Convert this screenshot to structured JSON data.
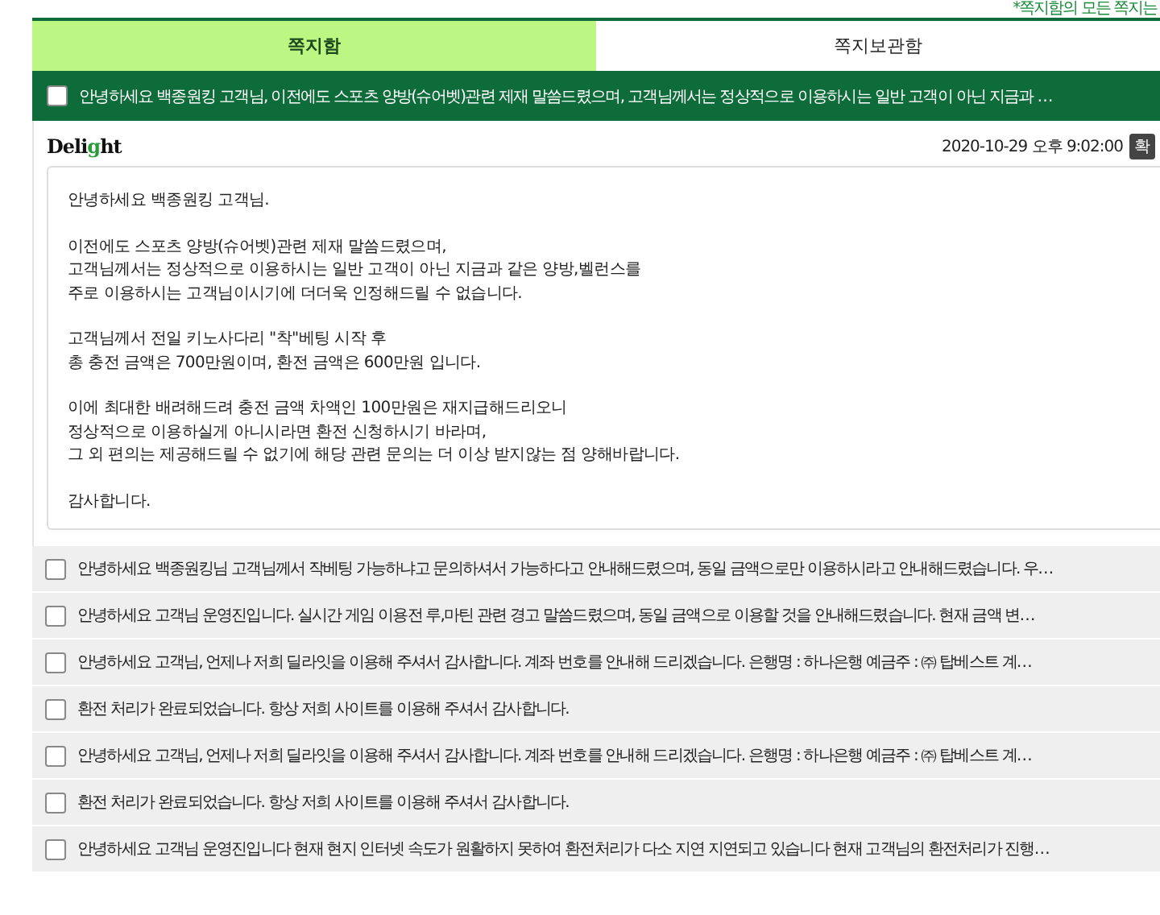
{
  "notice": "*쪽지함의 모든 쪽지는",
  "tabs": [
    {
      "label": "쪽지함",
      "selected": true
    },
    {
      "label": "쪽지보관함",
      "selected": false
    }
  ],
  "open_message": {
    "checked": false,
    "subject": "안녕하세요 백종원킹 고객님, 이전에도 스포츠 양방(슈어벳)관련 제재 말씀드렸으며, 고객님께서는 정상적으로 이용하시는 일반 고객이 아닌 지금과 …",
    "logo": {
      "pre": "Deli",
      "mid": "g",
      "post": "ht"
    },
    "date": "2020-10-29 오후 9:02:00",
    "badge": "확",
    "body": [
      [
        "안녕하세요 백종원킹 고객님."
      ],
      [
        "이전에도 스포츠 양방(슈어벳)관련 제재 말씀드렸으며,",
        "고객님께서는 정상적으로 이용하시는 일반 고객이 아닌 지금과 같은 양방,벨런스를",
        "주로 이용하시는 고객님이시기에 더더욱 인정해드릴 수 없습니다."
      ],
      [
        "고객님께서 전일 키노사다리 \"착\"베팅 시작 후",
        "총 충전 금액은 700만원이며, 환전 금액은 600만원 입니다."
      ],
      [
        "이에 최대한 배려해드려 충전 금액 차액인 100만원은 재지급해드리오니",
        "정상적으로 이용하실게 아니시라면 환전 신청하시기 바라며,",
        "그 외 편의는 제공해드릴 수 없기에 해당 관련 문의는 더 이상 받지않는 점 양해바랍니다."
      ],
      [
        "감사합니다."
      ]
    ]
  },
  "messages": [
    {
      "checked": false,
      "subject": "안녕하세요 백종원킹님 고객님께서 작베팅 가능하냐고 문의하셔서 가능하다고 안내해드렸으며, 동일 금액으로만 이용하시라고 안내해드렸습니다. 우…"
    },
    {
      "checked": false,
      "subject": "안녕하세요 고객님 운영진입니다. 실시간 게임 이용전 루,마틴 관련 경고 말씀드렸으며, 동일 금액으로 이용할 것을 안내해드렸습니다. 현재 금액 변…"
    },
    {
      "checked": false,
      "subject": "안녕하세요 고객님, 언제나 저희 딜라잇을 이용해 주셔서 감사합니다. 계좌 번호를 안내해 드리겠습니다. 은행명 : 하나은행 예금주 : ㈜ 탑베스트 계…"
    },
    {
      "checked": false,
      "subject": "환전 처리가 완료되었습니다. 항상 저희 사이트를 이용해 주셔서 감사합니다."
    },
    {
      "checked": false,
      "subject": "안녕하세요 고객님, 언제나 저희 딜라잇을 이용해 주셔서 감사합니다. 계좌 번호를 안내해 드리겠습니다. 은행명 : 하나은행 예금주 : ㈜ 탑베스트 계…"
    },
    {
      "checked": false,
      "subject": "환전 처리가 완료되었습니다. 항상 저희 사이트를 이용해 주셔서 감사합니다."
    },
    {
      "checked": false,
      "subject": "안녕하세요 고객님 운영진입니다 현재 현지 인터넷 속도가 원활하지 못하여 환전처리가 다소 지연 지연되고 있습니다 현재 고객님의 환전처리가 진행…"
    }
  ]
}
